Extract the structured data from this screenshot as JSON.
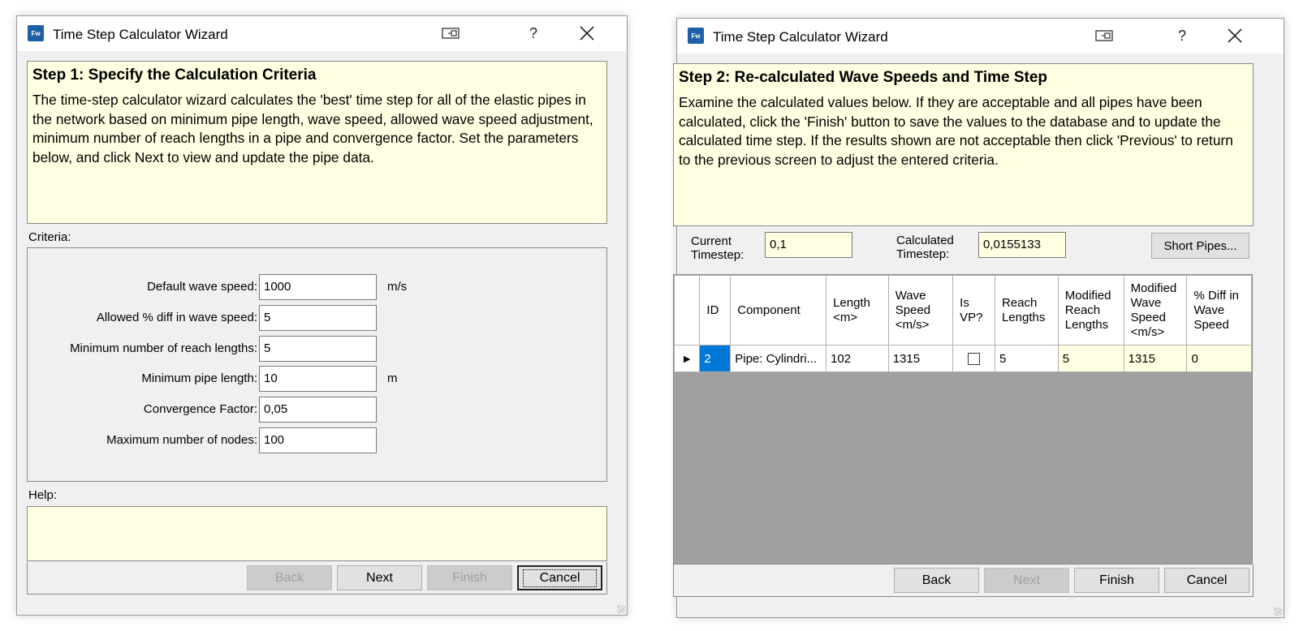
{
  "window1": {
    "title": "Time Step Calculator Wizard",
    "step_title": "Step 1: Specify the  Calculation Criteria",
    "step_description": "The time-step calculator wizard calculates the 'best' time step for all of the elastic pipes in the network based on minimum pipe length, wave speed, allowed wave speed adjustment, minimum number of reach lengths in a pipe and convergence factor. Set the parameters below, and click Next to view and update the pipe data.",
    "criteria_label": "Criteria:",
    "fields": [
      {
        "label": "Default wave speed:",
        "value": "1000",
        "unit": "m/s"
      },
      {
        "label": "Allowed % diff in wave speed:",
        "value": "5",
        "unit": ""
      },
      {
        "label": "Minimum number of reach lengths:",
        "value": "5",
        "unit": ""
      },
      {
        "label": "Minimum pipe length:",
        "value": "10",
        "unit": "m"
      },
      {
        "label": "Convergence Factor:",
        "value": "0,05",
        "unit": ""
      },
      {
        "label": "Maximum number of nodes:",
        "value": "100",
        "unit": ""
      }
    ],
    "help_label": "Help:",
    "buttons": {
      "back": "Back",
      "next": "Next",
      "finish": "Finish",
      "cancel": "Cancel"
    }
  },
  "window2": {
    "title": "Time Step Calculator Wizard",
    "step_title": "Step 2: Re-calculated Wave Speeds and Time Step",
    "step_description": "Examine the calculated values below. If they are acceptable and all pipes have been calculated, click the 'Finish' button to save the values to the database and to update the calculated time step. If the results shown are not acceptable then click 'Previous' to return to the previous screen to adjust the entered criteria.",
    "current_timestep_label": "Current Timestep:",
    "current_timestep_value": "0,1",
    "calculated_timestep_label": "Calculated Timestep:",
    "calculated_timestep_value": "0,0155133",
    "short_pipes_button": "Short Pipes...",
    "table": {
      "headers": [
        "ID",
        "Component",
        "Length <m>",
        "Wave Speed <m/s>",
        "Is VP?",
        "Reach Lengths",
        "Modified Reach Lengths",
        "Modified Wave Speed <m/s>",
        "% Diff in Wave Speed"
      ],
      "rows": [
        {
          "id": "2",
          "component": "Pipe: Cylindri...",
          "length": "102",
          "wave_speed": "1315",
          "is_vp": false,
          "reach_lengths": "5",
          "mod_reach_lengths": "5",
          "mod_wave_speed": "1315",
          "pct_diff": "0"
        }
      ]
    },
    "buttons": {
      "back": "Back",
      "next": "Next",
      "finish": "Finish",
      "cancel": "Cancel"
    }
  },
  "icons": {
    "app_icon_text": "Fw",
    "help": "?",
    "close": "✕",
    "row_indicator": "▶"
  },
  "colors": {
    "info_panel": "#ffffe1",
    "selection": "#0078d7",
    "grid_background": "#a0a0a0"
  }
}
